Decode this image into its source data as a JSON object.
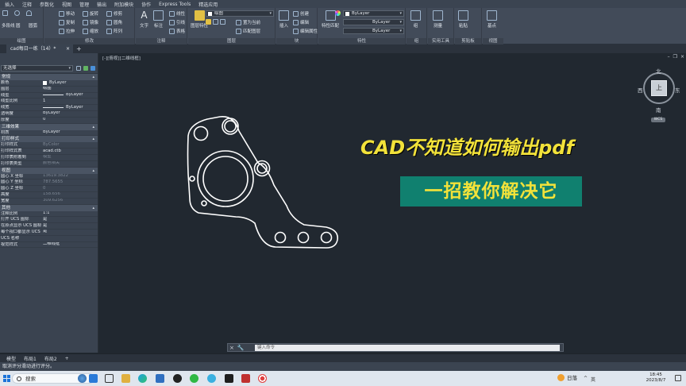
{
  "menu": [
    "插入",
    "注释",
    "参数化",
    "视图",
    "管理",
    "输出",
    "附加模块",
    "协作",
    "Express Tools",
    "精选应用"
  ],
  "ribbon": {
    "draw": {
      "label": "绘图",
      "tools": [
        "多段线",
        "圆",
        "圆弧"
      ]
    },
    "modify": {
      "label": "修改",
      "tools": [
        "移动",
        "旋转",
        "修剪",
        "复制",
        "镜像",
        "圆角",
        "拉伸",
        "缩放",
        "阵列"
      ]
    },
    "annotation": {
      "label": "注释",
      "tools": [
        "文字",
        "标注",
        "线性",
        "引线",
        "表格"
      ]
    },
    "layers": {
      "label": "图层",
      "tools": [
        "图层特性",
        "置为当前",
        "匹配图层"
      ],
      "current": "绘图"
    },
    "block": {
      "label": "块",
      "tools": [
        "插入",
        "创建",
        "编辑",
        "编辑属性"
      ]
    },
    "properties": {
      "label": "特性",
      "tools": [
        "特性匹配"
      ],
      "color": "ByLayer",
      "linetype": "ByLayer",
      "lineweight": "ByLayer"
    },
    "groups": {
      "label": "组",
      "tools": [
        "组"
      ]
    },
    "utilities": {
      "label": "实用工具",
      "tools": [
        "测量"
      ]
    },
    "clipboard": {
      "label": "剪贴板",
      "tools": [
        "粘贴"
      ]
    },
    "view": {
      "label": "视图",
      "tools": [
        "基点"
      ]
    }
  },
  "doc_tab": {
    "title": "cad每日一练（14）*",
    "close": "×",
    "plus": "+"
  },
  "props": {
    "selection": "无选择",
    "sections": [
      {
        "title": "常规",
        "rows": [
          {
            "k": "颜色",
            "v": "ByLayer",
            "swatch": "white"
          },
          {
            "k": "图层",
            "v": "绘图"
          },
          {
            "k": "线型",
            "v": "ByLayer",
            "swatch": "line"
          },
          {
            "k": "线型比例",
            "v": "1"
          },
          {
            "k": "线宽",
            "v": "ByLayer",
            "swatch": "line"
          },
          {
            "k": "透明度",
            "v": "ByLayer"
          },
          {
            "k": "厚度",
            "v": "0"
          }
        ]
      },
      {
        "title": "三维效果",
        "rows": [
          {
            "k": "材质",
            "v": "ByLayer"
          }
        ]
      },
      {
        "title": "打印样式",
        "rows": [
          {
            "k": "打印样式",
            "v": "ByColor",
            "dim": true
          },
          {
            "k": "打印样式表",
            "v": "acad.ctb"
          },
          {
            "k": "打印表附着到",
            "v": "模型",
            "dim": true
          },
          {
            "k": "打印表类型",
            "v": "颜色相关",
            "dim": true
          }
        ]
      },
      {
        "title": "视图",
        "rows": [
          {
            "k": "圆心 X 坐标",
            "v": "13619.3822",
            "dim": true
          },
          {
            "k": "圆心 Y 坐标",
            "v": "787.5655",
            "dim": true
          },
          {
            "k": "圆心 Z 坐标",
            "v": "0",
            "dim": true
          },
          {
            "k": "高度",
            "v": "158.656",
            "dim": true
          },
          {
            "k": "宽度",
            "v": "309.6256",
            "dim": true
          }
        ]
      },
      {
        "title": "其他",
        "rows": [
          {
            "k": "注释比例",
            "v": "1:1"
          },
          {
            "k": "打开 UCS 图标",
            "v": "是"
          },
          {
            "k": "在原点显示 UCS 图标",
            "v": "是"
          },
          {
            "k": "每个视口都显示 UCS",
            "v": "是"
          },
          {
            "k": "UCS 名称",
            "v": ""
          },
          {
            "k": "视觉样式",
            "v": "二维线框"
          }
        ]
      }
    ]
  },
  "canvas": {
    "viewport_label": "[-][俯视][二维线框]",
    "window_controls": [
      "–",
      "❐",
      "×"
    ]
  },
  "viewcube": {
    "north": "北",
    "south": "南",
    "east": "东",
    "west": "西",
    "face": "上",
    "wcs": "WCS"
  },
  "overlay": {
    "title": "CAD不知道如何输出pdf",
    "subtitle": "一招教你解决它"
  },
  "command": {
    "placeholder": "键入命令",
    "icons": [
      "×",
      "🔧"
    ]
  },
  "layout_tabs": [
    "模型",
    "布局1",
    "布局2",
    "+"
  ],
  "status": "取消评分滑动进行评分。",
  "taskbar": {
    "search": "搜索",
    "weather": "日落",
    "tray": [
      "^",
      "英"
    ],
    "time": "18:45",
    "date": "2023/8/7"
  },
  "colors": {
    "accent_teal": "#10806f",
    "overlay_yellow": "#f2e23a"
  }
}
